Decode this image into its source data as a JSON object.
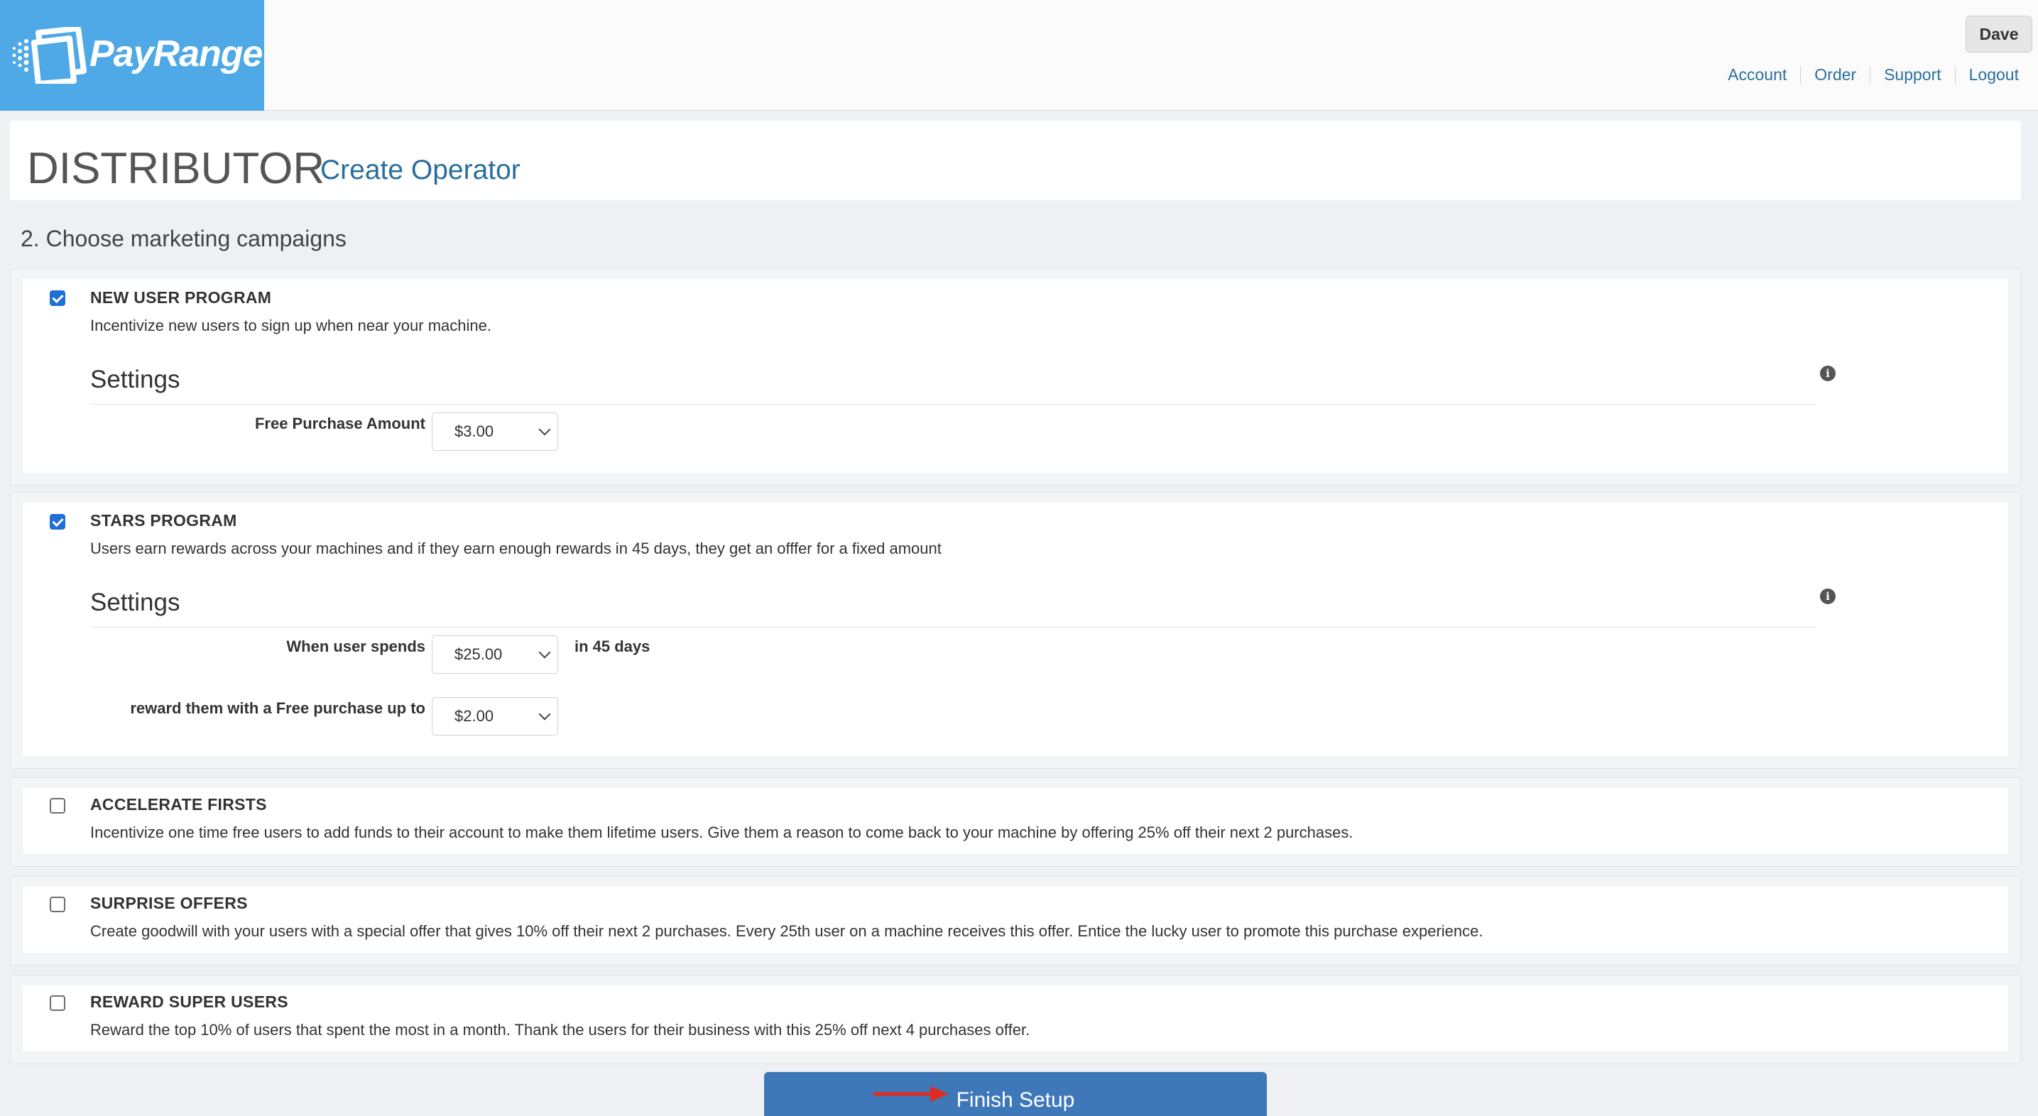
{
  "header": {
    "brand": "PayRange",
    "user_button": "Dave",
    "links": [
      "Account",
      "Order",
      "Support",
      "Logout"
    ]
  },
  "page": {
    "title": "DISTRIBUTOR",
    "subtitle": "Create Operator",
    "step_heading": "2. Choose marketing campaigns"
  },
  "campaigns": [
    {
      "title": "NEW USER PROGRAM",
      "checked": true,
      "description": "Incentivize new users to sign up when near your machine.",
      "settings_heading": "Settings",
      "fields": [
        {
          "label": "Free Purchase Amount",
          "value": "$3.00",
          "suffix": ""
        }
      ]
    },
    {
      "title": "STARS PROGRAM",
      "checked": true,
      "description": "Users earn rewards across your machines and if they earn enough rewards in 45 days, they get an offfer for a fixed amount",
      "settings_heading": "Settings",
      "fields": [
        {
          "label": "When user spends",
          "value": "$25.00",
          "suffix": "in 45 days"
        },
        {
          "label": "reward them with a Free purchase up to",
          "value": "$2.00",
          "suffix": ""
        }
      ]
    },
    {
      "title": "ACCELERATE FIRSTS",
      "checked": false,
      "description": "Incentivize one time free users to add funds to their account to make them lifetime users. Give them a reason to come back to your machine by offering 25% off their next 2 purchases."
    },
    {
      "title": "SURPRISE OFFERS",
      "checked": false,
      "description": "Create goodwill with your users with a special offer that gives 10% off their next 2 purchases. Every 25th user on a machine receives this offer. Entice the lucky user to promote this purchase experience."
    },
    {
      "title": "REWARD SUPER USERS",
      "checked": false,
      "description": "Reward the top 10% of users that spent the most in a month. Thank the users for their business with this 25% off next 4 purchases offer."
    }
  ],
  "finish_button": "Finish Setup",
  "colors": {
    "brand_blue": "#4ea9e6",
    "link": "#2a6f9c",
    "button": "#3f78b8",
    "checkbox": "#1f6fd6",
    "annotation_arrow": "#e02b20"
  },
  "icons": {
    "info": "info-icon",
    "dropdown": "chevron-down-icon",
    "logo": "payrange-logo-icon"
  }
}
